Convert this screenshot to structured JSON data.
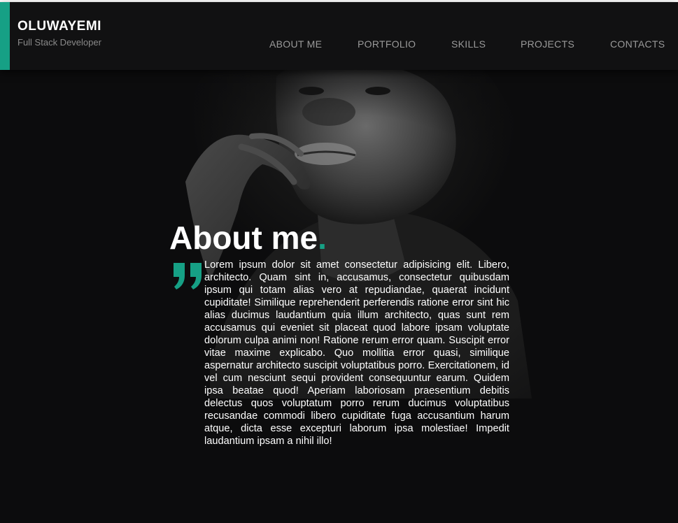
{
  "brand": {
    "name": "OLUWAYEMI",
    "subtitle": "Full Stack Developer"
  },
  "nav": {
    "items": [
      {
        "label": "ABOUT ME"
      },
      {
        "label": "PORTFOLIO"
      },
      {
        "label": "SKILLS"
      },
      {
        "label": "PROJECTS"
      },
      {
        "label": "CONTACTS"
      }
    ]
  },
  "about": {
    "title": "About me",
    "title_dot": ".",
    "quote_icon": "quote-icon",
    "body": "Lorem ipsum dolor sit amet consectetur adipisicing elit. Libero, architecto. Quam sint in, accusamus, consectetur quibusdam ipsum qui totam alias vero at repudiandae, quaerat incidunt cupiditate! Similique reprehenderit perferendis ratione error sint hic alias ducimus laudantium quia illum architecto, quas sunt rem accusamus qui eveniet sit placeat quod labore ipsam voluptate dolorum culpa animi non! Ratione rerum error quam. Suscipit error vitae maxime explicabo. Quo mollitia error quasi, similique aspernatur architecto suscipit voluptatibus porro. Exercitationem, id vel cum nesciunt sequi provident consequuntur earum. Quidem ipsa beatae quod! Aperiam laboriosam praesentium debitis delectus quos voluptatum porro rerum ducimus voluptatibus recusandae commodi libero cupiditate fuga accusantium harum atque, dicta esse excepturi laborum ipsa molestiae! Impedit laudantium ipsam a nihil illo!"
  },
  "colors": {
    "accent": "#16a085",
    "background": "#0c0c0d",
    "header": "#111112",
    "nav_text": "#9a9a9a"
  }
}
